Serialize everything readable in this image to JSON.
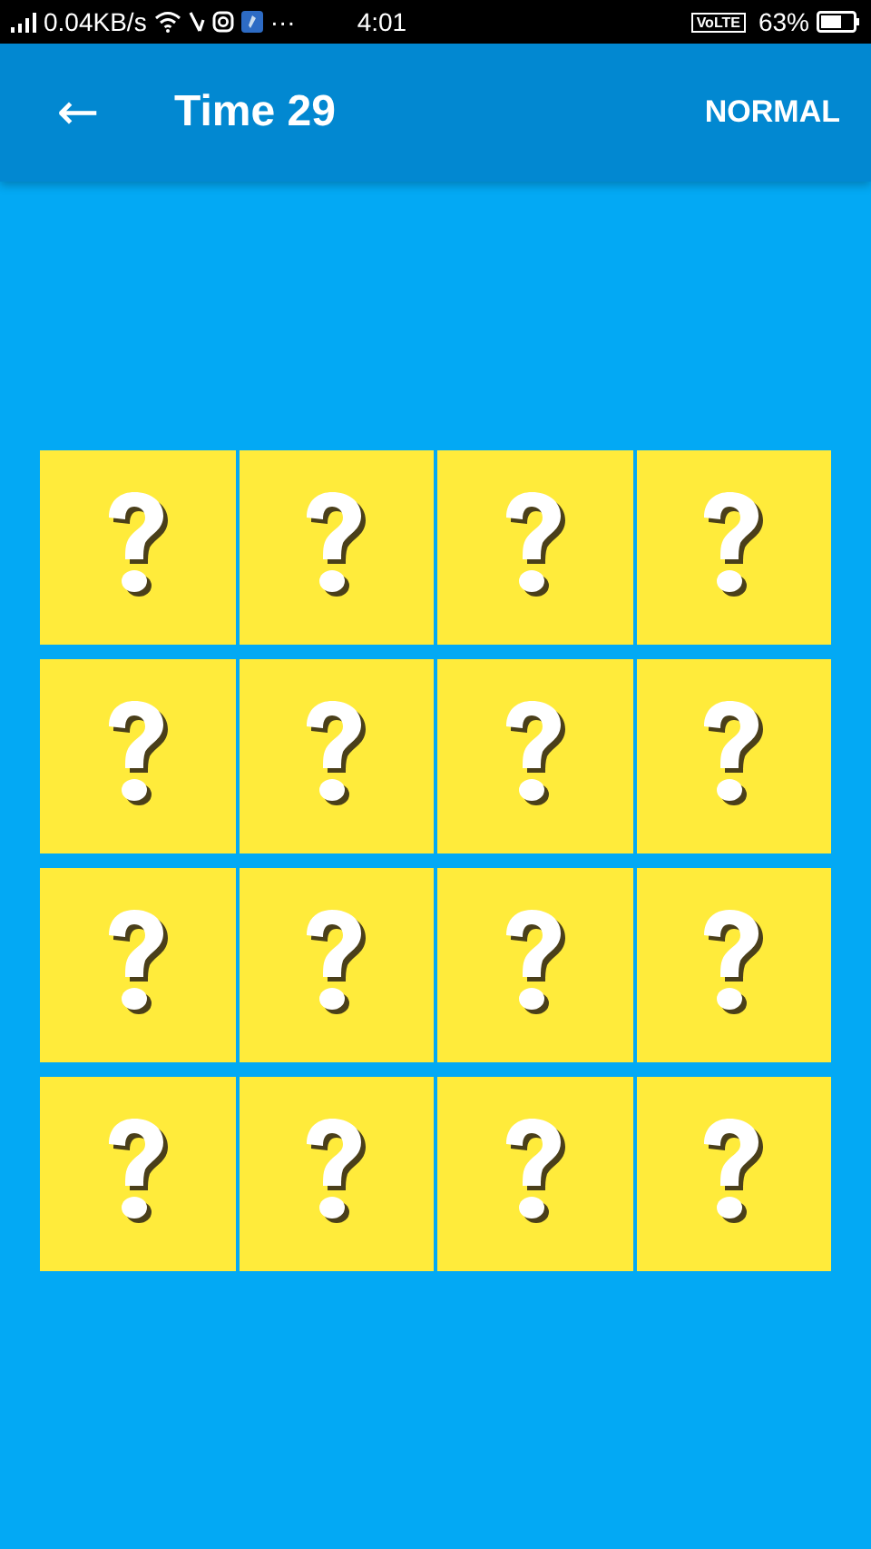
{
  "status_bar": {
    "speed": "0.04KB/s",
    "more": "···",
    "time": "4:01",
    "network": "VoLTE",
    "battery": "63%"
  },
  "toolbar": {
    "back": "←",
    "title": "Time 29",
    "mode": "NORMAL"
  },
  "cards": [
    {
      "face_up": false
    },
    {
      "face_up": false
    },
    {
      "face_up": false
    },
    {
      "face_up": false
    },
    {
      "face_up": false
    },
    {
      "face_up": false
    },
    {
      "face_up": false
    },
    {
      "face_up": false
    },
    {
      "face_up": false
    },
    {
      "face_up": false
    },
    {
      "face_up": false
    },
    {
      "face_up": false
    },
    {
      "face_up": false
    },
    {
      "face_up": false
    },
    {
      "face_up": false
    },
    {
      "face_up": false
    }
  ]
}
